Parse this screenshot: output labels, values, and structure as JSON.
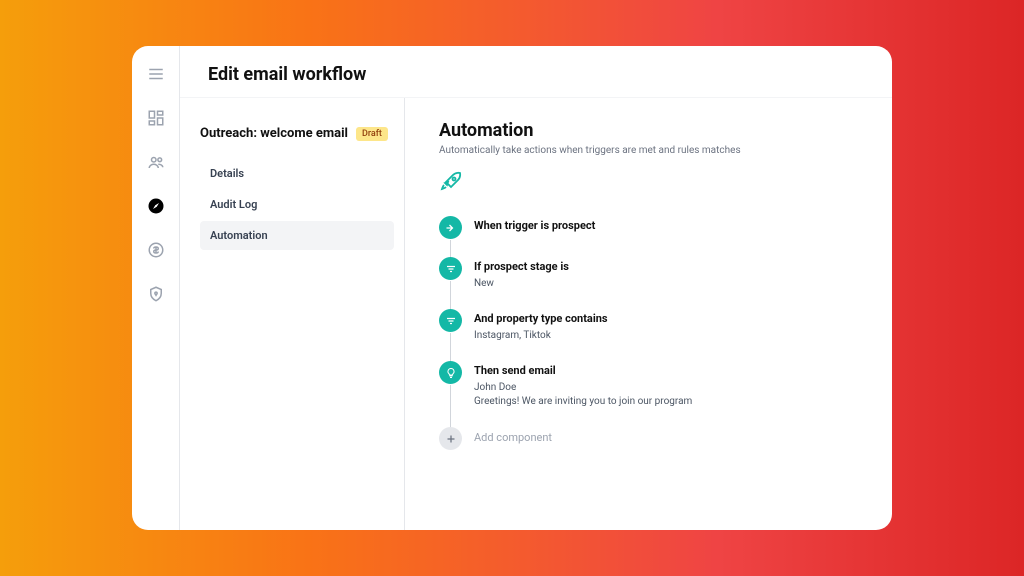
{
  "header": {
    "title": "Edit email workflow"
  },
  "workflow": {
    "name": "Outreach: welcome email",
    "status": "Draft"
  },
  "tabs": [
    {
      "label": "Details"
    },
    {
      "label": "Audit Log"
    },
    {
      "label": "Automation"
    }
  ],
  "automation": {
    "title": "Automation",
    "subtitle": "Automatically take actions when triggers are met and rules matches",
    "steps": [
      {
        "title": "When trigger is prospect",
        "value": ""
      },
      {
        "title": "If prospect stage is",
        "value": "New"
      },
      {
        "title": "And property type contains",
        "value": "Instagram, Tiktok"
      },
      {
        "title": "Then send email",
        "value": "John Doe\nGreetings! We are inviting you to join our program"
      }
    ],
    "add_label": "Add component"
  }
}
